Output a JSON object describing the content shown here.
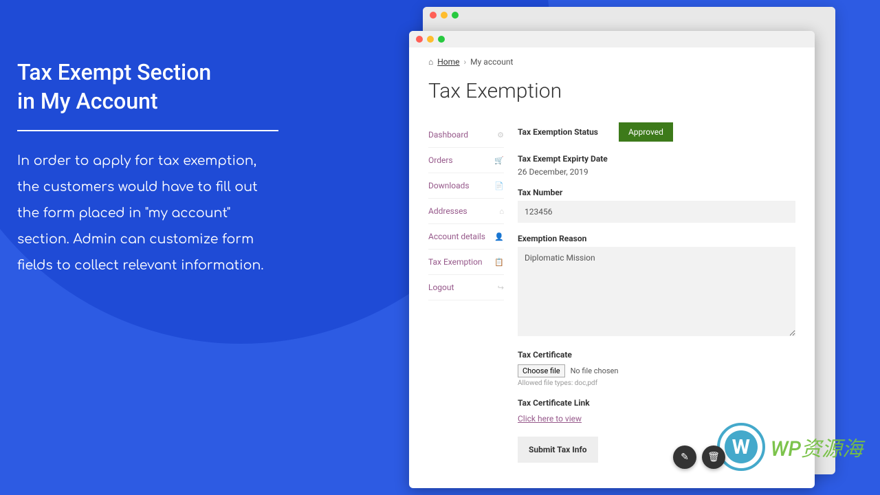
{
  "hero": {
    "title_line1": "Tax Exempt Section",
    "title_line2": "in My Account",
    "description": "In order to apply for tax exemption, the customers would have to fill out the form placed in \"my account\" section. Admin can customize form fields to collect relevant information."
  },
  "breadcrumb": {
    "home": "Home",
    "current": "My account"
  },
  "page": {
    "title": "Tax Exemption"
  },
  "sidebar": {
    "items": [
      {
        "label": "Dashboard",
        "icon": "⚙"
      },
      {
        "label": "Orders",
        "icon": "🛒"
      },
      {
        "label": "Downloads",
        "icon": "📄"
      },
      {
        "label": "Addresses",
        "icon": "⌂"
      },
      {
        "label": "Account details",
        "icon": "👤"
      },
      {
        "label": "Tax Exemption",
        "icon": "📋",
        "active": true
      },
      {
        "label": "Logout",
        "icon": "↪"
      }
    ]
  },
  "form": {
    "status_label": "Tax Exemption Status",
    "status_value": "Approved",
    "expiry_label": "Tax Exempt Expirty Date",
    "expiry_value": "26 December, 2019",
    "tax_number_label": "Tax Number",
    "tax_number_value": "123456",
    "reason_label": "Exemption Reason",
    "reason_value": "Diplomatic Mission",
    "certificate_label": "Tax Certificate",
    "choose_file": "Choose file",
    "no_file": "No file chosen",
    "file_hint": "Allowed file types: doc,pdf",
    "cert_link_label": "Tax Certificate Link",
    "cert_link_text": "Click here to view",
    "submit": "Submit Tax Info"
  },
  "watermark": {
    "logo_letter": "W",
    "text": "WP资源海"
  }
}
